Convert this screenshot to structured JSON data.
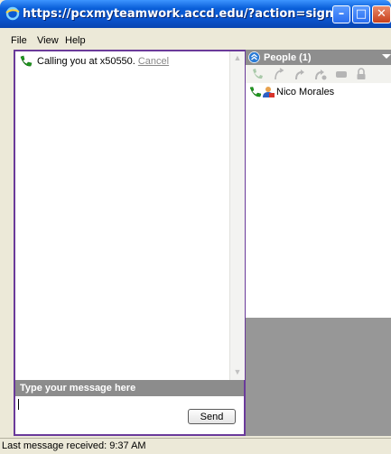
{
  "window": {
    "title": "https://pcxmyteamwork.accd.edu/?action=sign...",
    "min_symbol": "–",
    "max_symbol": "□",
    "close_symbol": "✕"
  },
  "menu": {
    "items": [
      "File",
      "View",
      "Help"
    ]
  },
  "chat": {
    "call_status": "Calling you at x50550.",
    "cancel_label": "Cancel",
    "compose_header": "Type your message here",
    "send_label": "Send"
  },
  "people": {
    "header": "People (1)",
    "members": [
      {
        "name": "Nico Morales"
      }
    ]
  },
  "status": {
    "text": "Last message received: 9:37 AM"
  },
  "colors": {
    "accent_border": "#6a3a9a",
    "phone_green": "#1e9a1e",
    "titlebar_blue": "#0a53cc"
  },
  "icons": {
    "toolbar": [
      "phone-icon",
      "transfer-call-icon",
      "forward-call-icon",
      "conference-call-icon",
      "video-icon",
      "lock-icon"
    ]
  }
}
